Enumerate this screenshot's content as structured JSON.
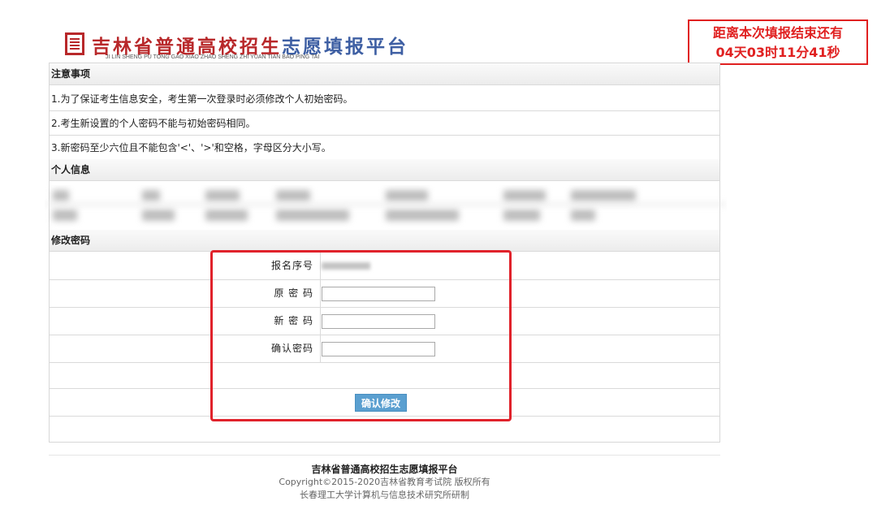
{
  "header": {
    "title_red": "吉林省普通高校招生",
    "title_blue": "志愿填报平台",
    "pinyin": "JI LIN SHENG PU TONG GAO XIAO ZHAO SHENG  ZHI  YUAN TIAN BAO PING TAI"
  },
  "deadline": {
    "line1": "距离本次填报结束还有",
    "line2": "04天03时11分41秒",
    "color": "#e02020"
  },
  "notes": {
    "heading": "注意事项",
    "items": [
      "1.为了保证考生信息安全，考生第一次登录时必须修改个人初始密码。",
      "2.考生新设置的个人密码不能与初始密码相同。",
      "3.新密码至少六位且不能包含'<'、'>'和空格，字母区分大小写。"
    ]
  },
  "personal_info": {
    "heading": "个人信息"
  },
  "change_password": {
    "heading": "修改密码",
    "fields": {
      "reg_no_label": "报名序号",
      "old_label": "原 密 码",
      "new_label": "新 密 码",
      "confirm_label": "确认密码"
    },
    "submit_label": "确认修改"
  },
  "footer": {
    "title": "吉林省普通高校招生志愿填报平台",
    "copyright": "Copyright©2015-2020吉林省教育考试院 版权所有",
    "developer": "长春理工大学计算机与信息技术研究所研制"
  },
  "colors": {
    "brand_red": "#b8282a",
    "brand_blue": "#3e5fa3",
    "button_blue": "#5a9fd0",
    "highlight_red": "#e0222b"
  }
}
